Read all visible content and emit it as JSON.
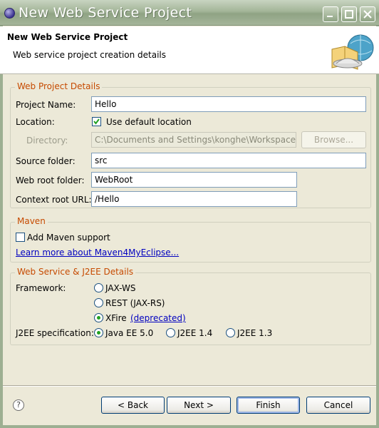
{
  "window": {
    "title": "New Web Service Project"
  },
  "header": {
    "title": "New Web Service Project",
    "description": "Web service project creation details"
  },
  "web_project": {
    "legend": "Web Project Details",
    "project_name_label": "Project Name:",
    "project_name_value": "Hello",
    "location_label": "Location:",
    "use_default_label": "Use default location",
    "use_default_checked": true,
    "directory_label": "Directory:",
    "directory_value": "C:\\Documents and Settings\\konghe\\Workspaces\\",
    "browse_label": "Browse...",
    "source_folder_label": "Source folder:",
    "source_folder_value": "src",
    "web_root_label": "Web root folder:",
    "web_root_value": "WebRoot",
    "context_root_label": "Context root URL:",
    "context_root_value": "/Hello"
  },
  "maven": {
    "legend": "Maven",
    "add_support_label": "Add Maven support",
    "add_support_checked": false,
    "learn_more_link": "Learn more about Maven4MyEclipse..."
  },
  "ws": {
    "legend": "Web Service & J2EE Details",
    "framework_label": "Framework:",
    "frameworks": [
      {
        "label": "JAX-WS",
        "selected": false
      },
      {
        "label": "REST (JAX-RS)",
        "selected": false
      },
      {
        "label": "XFire",
        "extra": "(deprecated)",
        "selected": true
      }
    ],
    "j2ee_label": "J2EE specification:",
    "j2ee_options": [
      {
        "label": "Java EE 5.0",
        "selected": true
      },
      {
        "label": "J2EE 1.4",
        "selected": false
      },
      {
        "label": "J2EE 1.3",
        "selected": false
      }
    ]
  },
  "footer": {
    "help_symbol": "?",
    "back_label": "< Back",
    "next_label": "Next >",
    "finish_label": "Finish",
    "cancel_label": "Cancel"
  },
  "colors": {
    "legend": "#c64a00",
    "link": "#0000c0",
    "titlebar": "#a3b598"
  }
}
